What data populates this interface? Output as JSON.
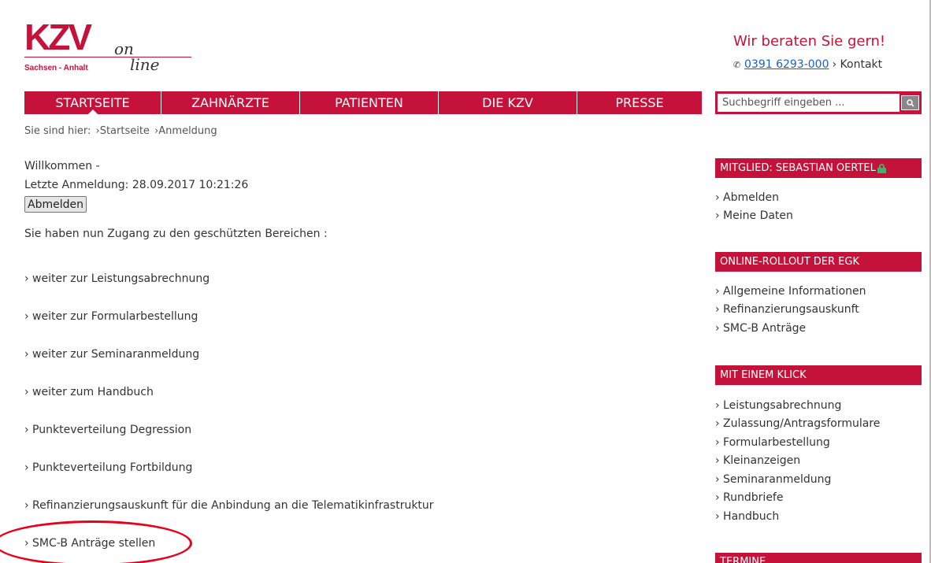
{
  "header": {
    "logo": {
      "brand": "KZV",
      "region": "Sachsen - Anhalt",
      "on": "on",
      "line": "line"
    },
    "contact_title": "Wir beraten Sie gern!",
    "phone": "0391 6293-000",
    "kontakt": "› Kontakt"
  },
  "nav": {
    "items": [
      "STARTSEITE",
      "ZAHNÄRZTE",
      "PATIENTEN",
      "DIE KZV",
      "PRESSE"
    ],
    "active": "STARTSEITE",
    "search_placeholder": "Suchbegriff eingeben ..."
  },
  "breadcrumb": {
    "prefix": "Sie sind hier:",
    "items": [
      "›Startseite",
      "›Anmeldung"
    ]
  },
  "main": {
    "welcome": "Willkommen -",
    "last_login": "Letzte Anmeldung: 28.09.2017 10:21:26",
    "logout_button": "Abmelden",
    "access_text": "Sie haben nun Zugang zu den geschützten Bereichen :",
    "links": [
      "› weiter zur Leistungsabrechnung",
      "› weiter zur Formularbestellung",
      "› weiter zur Seminaranmeldung",
      "› weiter zum Handbuch",
      "› Punkteverteilung Degression",
      "› Punkteverteilung Fortbildung",
      "› Refinanzierungsauskunft für die Anbindung an die Telematikinfrastruktur",
      "› SMC-B Anträge stellen"
    ]
  },
  "sidebar": {
    "member": {
      "title": "MITGLIED: SEBASTIAN OERTEL",
      "links": [
        "› Abmelden",
        "› Meine Daten"
      ]
    },
    "egk": {
      "title": "ONLINE-ROLLOUT DER EGK",
      "links": [
        "› Allgemeine Informationen",
        "› Refinanzierungsauskunft",
        "› SMC-B Anträge"
      ]
    },
    "klick": {
      "title": "MIT EINEM KLICK",
      "links": [
        "› Leistungsabrechnung",
        "› Zulassung/Antragsformulare",
        "› Formularbestellung",
        "› Kleinanzeigen",
        "› Seminaranmeldung",
        "› Rundbriefe",
        "› Handbuch"
      ]
    },
    "termine": {
      "title": "TERMINE"
    }
  },
  "colors": {
    "brand": "#c4123a",
    "link": "#1a5fc7",
    "highlight": "#e8001c"
  }
}
